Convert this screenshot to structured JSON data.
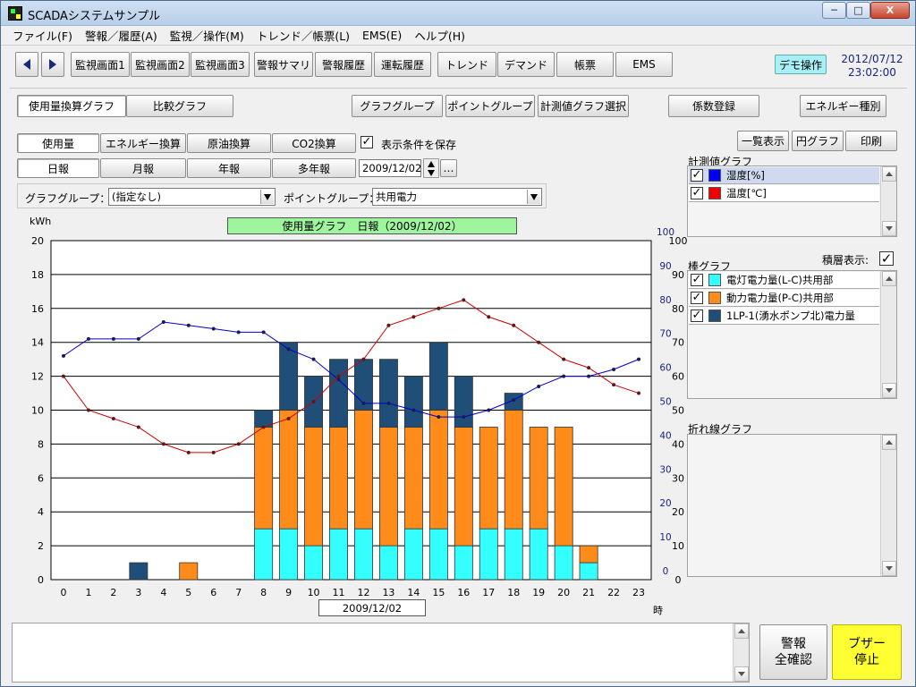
{
  "window": {
    "title": "SCADAシステムサンプル",
    "min": "─",
    "max": "□",
    "close": "X"
  },
  "menu": [
    "ファイル(F)",
    "警報／履歴(A)",
    "監視／操作(M)",
    "トレンド／帳票(L)",
    "EMS(E)",
    "ヘルプ(H)"
  ],
  "toolbar": {
    "buttons": [
      "監視画面1",
      "監視画面2",
      "監視画面3",
      "警報サマリ",
      "警報履歴",
      "運転履歴",
      "トレンド",
      "デマンド",
      "帳票",
      "EMS"
    ],
    "demo": "デモ操作",
    "date": "2012/07/12",
    "time": "23:02:00"
  },
  "tabs": {
    "usage": "使用量換算グラフ",
    "compare": "比較グラフ"
  },
  "top_buttons": [
    "グラフグループ",
    "ポイントグループ",
    "計測値グラフ選択",
    "係数登録",
    "エネルギー種別"
  ],
  "conv": [
    "使用量",
    "エネルギー換算",
    "原油換算",
    "CO2換算"
  ],
  "save_label": "表示条件を保存",
  "periods": [
    "日報",
    "月報",
    "年報",
    "多年報"
  ],
  "date_value": "2009/12/02",
  "more": "…",
  "group": {
    "graph_label": "グラフグループ：",
    "graph_value": "(指定なし)",
    "point_label": "ポイントグループ：",
    "point_value": "共用電力"
  },
  "right": {
    "list_view": "一覧表示",
    "pie": "円グラフ",
    "print": "印刷",
    "measure_title": "計測値グラフ",
    "measure_items": [
      {
        "label": "湿度[%]",
        "color": "#0000ee"
      },
      {
        "label": "温度[℃]",
        "color": "#ee0000"
      }
    ],
    "bar_title": "棒グラフ",
    "stack_label": "積層表示:",
    "bar_items": [
      {
        "label": "電灯電力量(L-C)共用部",
        "color": "#33ffff"
      },
      {
        "label": "動力電力量(P-C)共用部",
        "color": "#ff8c1a"
      },
      {
        "label": "1LP-1(湧水ポンプ北)電力量",
        "color": "#1f4e79"
      }
    ],
    "line_title": "折れ線グラフ"
  },
  "footer": {
    "ack": "警報\n全確認",
    "ack1": "警報",
    "ack2": "全確認",
    "buzzer1": "ブザー",
    "buzzer2": "停止"
  },
  "chart_data": {
    "type": "bar",
    "title": "使用量グラフ　日報（2009/12/02）",
    "ylabel": "kWh",
    "xlabel": "時",
    "date_label": "2009/12/02",
    "ylim": [
      0,
      20
    ],
    "yticks": [
      0,
      2,
      4,
      6,
      8,
      10,
      12,
      14,
      16,
      18,
      20
    ],
    "y2ticks_outer": [
      0,
      10,
      20,
      30,
      40,
      50,
      60,
      70,
      80,
      90,
      100
    ],
    "y2ticks_inner": [
      0,
      10,
      20,
      30,
      40,
      50,
      60,
      70,
      80,
      90,
      100
    ],
    "categories": [
      "0",
      "1",
      "2",
      "3",
      "4",
      "5",
      "6",
      "7",
      "8",
      "9",
      "10",
      "11",
      "12",
      "13",
      "14",
      "15",
      "16",
      "17",
      "18",
      "19",
      "20",
      "21",
      "22",
      "23"
    ],
    "stacked": true,
    "series": [
      {
        "name": "電灯電力量(L-C)共用部",
        "color": "#33ffff",
        "values": [
          0,
          0,
          0,
          0,
          0,
          0,
          0,
          0,
          3,
          3,
          2,
          3,
          3,
          2,
          3,
          3,
          2,
          3,
          3,
          3,
          2,
          1,
          0,
          0
        ]
      },
      {
        "name": "動力電力量(P-C)共用部",
        "color": "#ff8c1a",
        "values": [
          0,
          0,
          0,
          0,
          0,
          1,
          0,
          0,
          6,
          7,
          7,
          6,
          7,
          7,
          6,
          7,
          7,
          6,
          7,
          6,
          7,
          1,
          0,
          0
        ]
      },
      {
        "name": "1LP-1(湧水ポンプ北)電力量",
        "color": "#1f4e79",
        "values": [
          0,
          0,
          0,
          1,
          0,
          0,
          0,
          0,
          1,
          4,
          3,
          4,
          3,
          4,
          3,
          4,
          3,
          0,
          1,
          0,
          0,
          0,
          0,
          0
        ]
      }
    ],
    "lines": [
      {
        "name": "湿度[%]",
        "color": "#0000cc",
        "values": [
          66,
          71,
          71,
          71,
          76,
          75,
          74,
          73,
          73,
          68,
          65,
          59,
          52,
          52,
          50,
          48,
          48,
          50,
          53,
          57,
          60,
          60,
          62,
          65
        ]
      },
      {
        "name": "温度[℃]",
        "color": "#cc0000",
        "values": [
          12,
          10,
          9.5,
          9,
          8,
          7.5,
          7.5,
          8,
          9,
          9.5,
          10.5,
          12,
          13,
          15,
          15.5,
          16,
          16.5,
          15.5,
          15,
          14,
          13,
          12.5,
          11.5,
          11
        ]
      }
    ]
  }
}
